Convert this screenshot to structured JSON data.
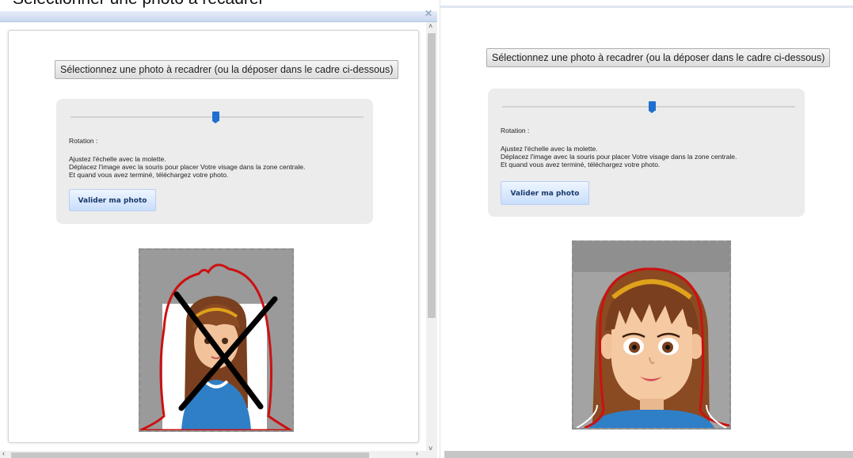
{
  "heading": {
    "text": "Sélectionner une photo à recadrer"
  },
  "left_window": {
    "select_button_label": "Sélectionnez une photo à recadrer (ou la déposer dans le cadre ci-dessous)",
    "zoom_slider_value": 0.5,
    "rotation_label": "Rotation :",
    "instructions": [
      "Ajustez l'échelle avec la molette.",
      "Déplacez l'image avec la souris pour placer Votre visage dans la zone centrale.",
      "Et quand vous avez terminé, téléchargez votre photo."
    ],
    "validate_button_label": "Valider ma photo",
    "preview_status": "crossed-out (incorrect framing)"
  },
  "right_window": {
    "select_button_label": "Sélectionnez une photo à recadrer (ou la déposer dans le cadre ci-dessous)",
    "zoom_slider_value": 0.5,
    "rotation_label": "Rotation :",
    "instructions": [
      "Ajustez l'échelle avec la molette.",
      "Déplacez l'image avec la souris pour placer Votre visage dans la zone centrale.",
      "Et quand vous avez terminé, téléchargez votre photo."
    ],
    "validate_button_label": "Valider ma photo",
    "preview_status": "correct framing"
  },
  "icons": {
    "close": "close-icon",
    "scroll_up": "chevron-up-icon",
    "scroll_down": "chevron-down-icon",
    "scroll_left": "chevron-left-icon",
    "scroll_right": "chevron-right-icon"
  },
  "colors": {
    "slider_handle": "#1f6fd1",
    "validate_button_text": "#1b3a6b",
    "guide_outline": "#cc1111",
    "panel_bg": "#ececec"
  }
}
